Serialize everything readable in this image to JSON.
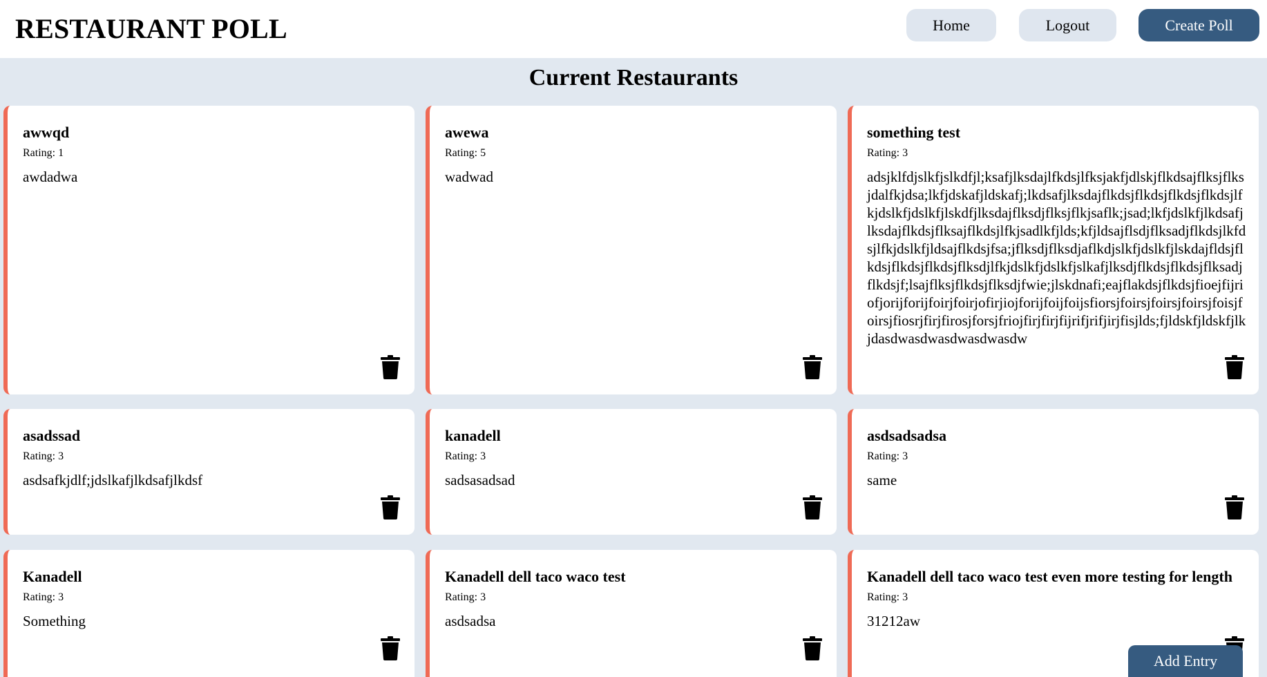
{
  "header": {
    "title": "RESTAURANT POLL",
    "home_label": "Home",
    "logout_label": "Logout",
    "create_label": "Create Poll"
  },
  "section_title": "Current Restaurants",
  "rating_prefix": "Rating: ",
  "colors": {
    "accent_border": "#ef6a55",
    "primary_button": "#365b80",
    "secondary_button": "#dfe6ef",
    "page_background": "#e1e8f0"
  },
  "cards": [
    {
      "name": "awwqd",
      "rating": "1",
      "description": "awdadwa"
    },
    {
      "name": "awewa",
      "rating": "5",
      "description": "wadwad"
    },
    {
      "name": "something test",
      "rating": "3",
      "description": "adsjklfdjslkfjslkdfjl;ksafjlksdajlfkdsjlfksjakfjdlskjflkdsajflksjflksjdalfkjdsa;lkfjdskafjldskafj;lkdsafjlksdajflkdsjflkdsjflkdsjflkdsjlfkjdslkfjdslkfjlskdfjlksdajflksdjflksjflkjsaflk;jsad;lkfjdslkfjlkdsafjlksdajflkdsjflksajflkdsjlfkjsadlkfjlds;kfjldsajflsdjflksadjflkdsjlkfdsjlfkjdslkfjldsajflkdsjfsa;jflksdjflksdjaflkdjslkfjdslkfjlskdajfldsjflkdsjflkdsjflkdsjflksdjlfkjdslkfjdslkfjslkafjlksdjflkdsjflkdsjflksadjflkdsjf;lsajflksjflkdsjflksdjfwie;jlskdnafi;eajflakdsjflkdsjfioejfijriofjorijforijfoirjfoirjofirjiojforijfoijfoijsfiorsjfoirsjfoirsjfoirsjfoisjfoirsjfiosrjfirjfirosjforsjfriojfirjfirjfijrifjrifjirjfisjlds;fjldskfjldskfjlkjdasdwasdwasdwasdwasdw"
    },
    {
      "name": "asadssad",
      "rating": "3",
      "description": "asdsafkjdlf;jdslkafjlkdsafjlkdsf"
    },
    {
      "name": "kanadell",
      "rating": "3",
      "description": "sadsasadsad"
    },
    {
      "name": "asdsadsadsa",
      "rating": "3",
      "description": "same"
    },
    {
      "name": "Kanadell",
      "rating": "3",
      "description": "Something"
    },
    {
      "name": "Kanadell dell taco waco test",
      "rating": "3",
      "description": "asdsadsa"
    },
    {
      "name": "Kanadell dell taco waco test even more testing for length",
      "rating": "3",
      "description": "31212aw"
    }
  ],
  "add_entry_label": "Add Entry",
  "icons": {
    "delete": "trash-icon"
  }
}
